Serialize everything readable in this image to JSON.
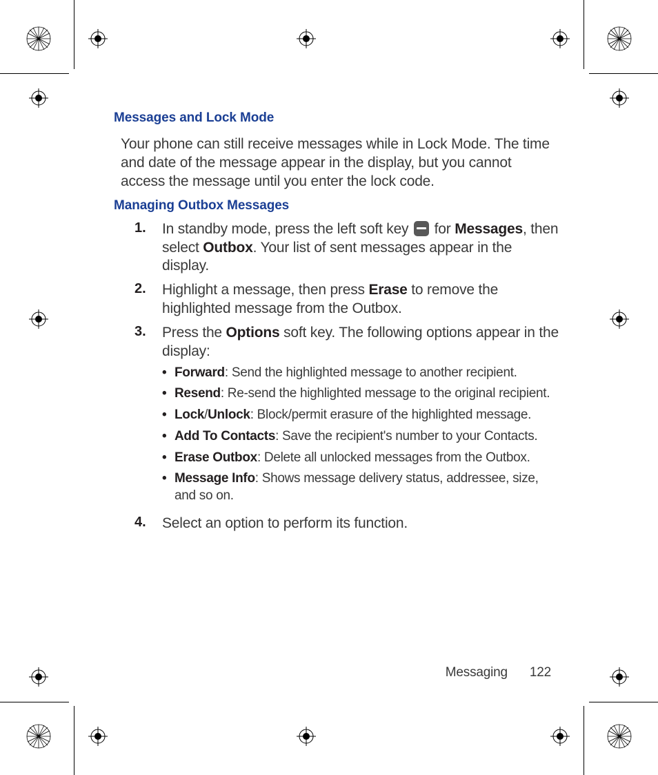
{
  "heading1": "Messages and Lock Mode",
  "para1": "Your phone can still receive messages while in Lock Mode. The time and date of the message appear in the display, but you cannot access the message until you enter the lock code.",
  "heading2": "Managing Outbox Messages",
  "steps": [
    {
      "num": "1.",
      "pre": "In standby mode, press the left soft key ",
      "post_for": " for ",
      "b_messages": "Messages",
      "post_then": ", then select ",
      "b_outbox": "Outbox",
      "tail": ". Your list of sent messages appear in the display."
    },
    {
      "num": "2.",
      "pre": "Highlight a message, then press ",
      "b_erase": "Erase",
      "tail": " to remove the highlighted message from the Outbox."
    },
    {
      "num": "3.",
      "pre": "Press the ",
      "b_options": "Options",
      "tail": " soft key. The following options appear in the display:"
    },
    {
      "num": "4.",
      "text": "Select an option to perform its function."
    }
  ],
  "options": [
    {
      "name": "Forward",
      "desc": ": Send the highlighted message to another recipient."
    },
    {
      "name": "Resend",
      "desc": ": Re-send the highlighted message to the original recipient."
    },
    {
      "name": "Lock",
      "sep": "/",
      "name2": "Unlock",
      "desc": ": Block/permit erasure of the highlighted message."
    },
    {
      "name": "Add To Contacts",
      "desc": ": Save the recipient's number to your Contacts."
    },
    {
      "name": "Erase Outbox",
      "desc": ": Delete all unlocked messages from the Outbox."
    },
    {
      "name": "Message Info",
      "desc": ": Shows message delivery status, addressee, size, and so on."
    }
  ],
  "footer": {
    "chapter": "Messaging",
    "page": "122"
  },
  "bullet": "•"
}
